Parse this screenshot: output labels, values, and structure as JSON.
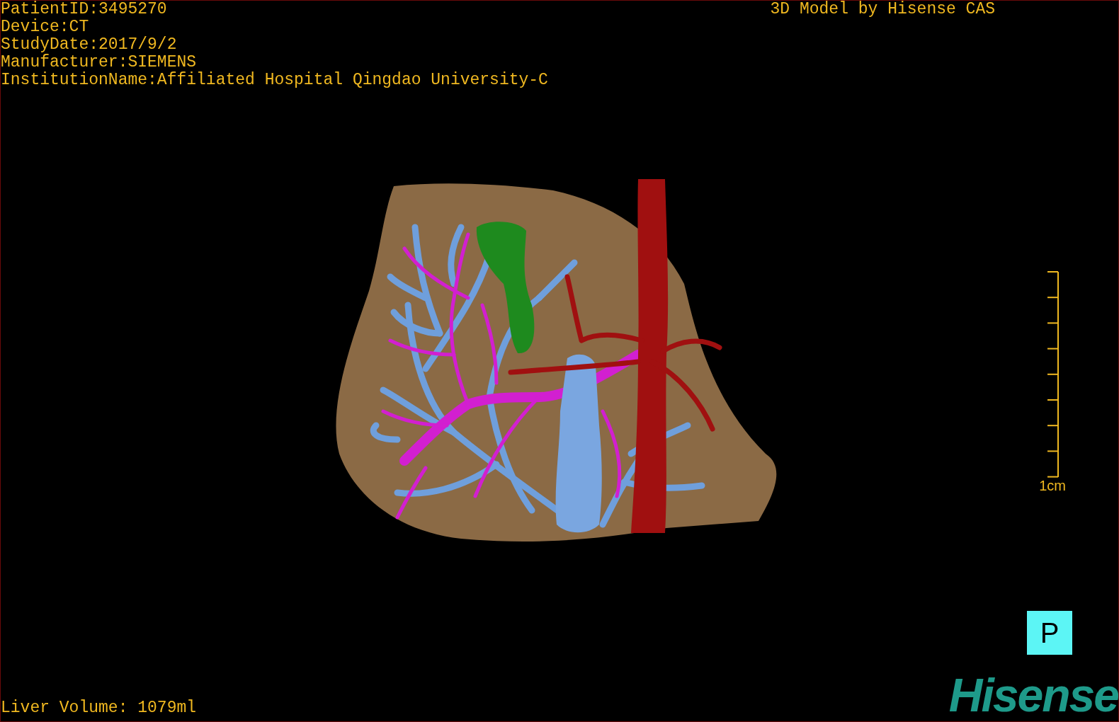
{
  "patient_info": [
    "PatientID:3495270",
    "Device:CT",
    "StudyDate:2017/9/2",
    "Manufacturer:SIEMENS",
    "InstitutionName:Affiliated Hospital Qingdao University-C"
  ],
  "credit": "3D Model by Hisense CAS",
  "scale_bar": {
    "label": "1cm"
  },
  "orientation": "P",
  "liver_volume": "Liver Volume: 1079ml",
  "logo": "Hisense"
}
